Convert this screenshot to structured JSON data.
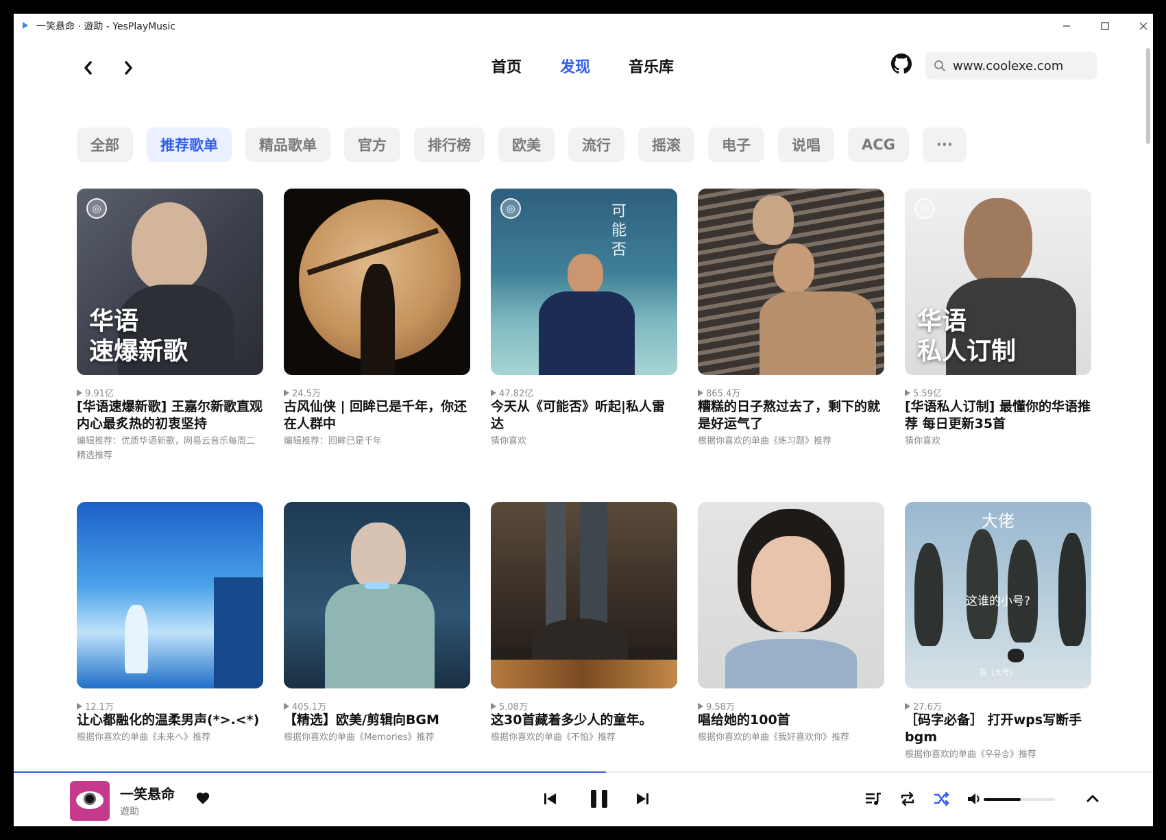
{
  "window": {
    "title": "一笑悬命 · 遊助 - YesPlayMusic"
  },
  "nav": {
    "back": "‹",
    "forward": "›",
    "items": [
      "首页",
      "发现",
      "音乐库"
    ],
    "active": "发现"
  },
  "search": {
    "value": "www.coolexe.com"
  },
  "categories": [
    "全部",
    "推荐歌单",
    "精品歌单",
    "官方",
    "排行榜",
    "欧美",
    "流行",
    "摇滚",
    "电子",
    "说唱",
    "ACG",
    "···"
  ],
  "active_category": "推荐歌单",
  "playlists": [
    {
      "count": "9.91亿",
      "title": "[华语速爆新歌] 王嘉尔新歌直观内心最炙热的初衷坚持",
      "subtitle": "编辑推荐：优质华语新歌，网易云音乐每周二精选推荐",
      "overlay1": "华语",
      "overlay2": "速爆新歌"
    },
    {
      "count": "24.5万",
      "title": "古风仙侠 | 回眸已是千年，你还在人群中",
      "subtitle": "编辑推荐：回眸已是千年"
    },
    {
      "count": "47.82亿",
      "title": "今天从《可能否》听起|私人雷达",
      "subtitle": "猜你喜欢",
      "vert": "可能否"
    },
    {
      "count": "865.4万",
      "title": "糟糕的日子熬过去了，剩下的就是好运气了",
      "subtitle": "根据你喜欢的单曲《练习题》推荐"
    },
    {
      "count": "5.59亿",
      "title": "[华语私人订制] 最懂你的华语推荐 每日更新35首",
      "subtitle": "猜你喜欢",
      "overlay1": "华语",
      "overlay2": "私人订制"
    },
    {
      "count": "12.1万",
      "title": "让心都融化的温柔男声(*>.<*)",
      "subtitle": "根据你喜欢的单曲《未来へ》推荐"
    },
    {
      "count": "405.1万",
      "title": "【精选】欧美/剪辑向BGM",
      "subtitle": "根据你喜欢的单曲《Memories》推荐"
    },
    {
      "count": "5.08万",
      "title": "这30首藏着多少人的童年。",
      "subtitle": "根据你喜欢的单曲《不怕》推荐"
    },
    {
      "count": "9.58万",
      "title": "唱给她的100首",
      "subtitle": "根据你喜欢的单曲《我好喜欢你》推荐"
    },
    {
      "count": "27.6万",
      "title": "［码字必备］ 打开wps写断手bgm",
      "subtitle": "根据你喜欢的单曲《우유송》推荐",
      "topcap": "大佬",
      "midcap": "这谁的小号?",
      "botcap": "我（大号）"
    }
  ],
  "player": {
    "song": "一笑悬命",
    "artist": "遊助",
    "progress": 0.52,
    "volume": 0.52
  },
  "colors": {
    "accent": "#335eea",
    "accent_bg": "#eaf0ff",
    "chip_bg": "#f2f2f4"
  }
}
